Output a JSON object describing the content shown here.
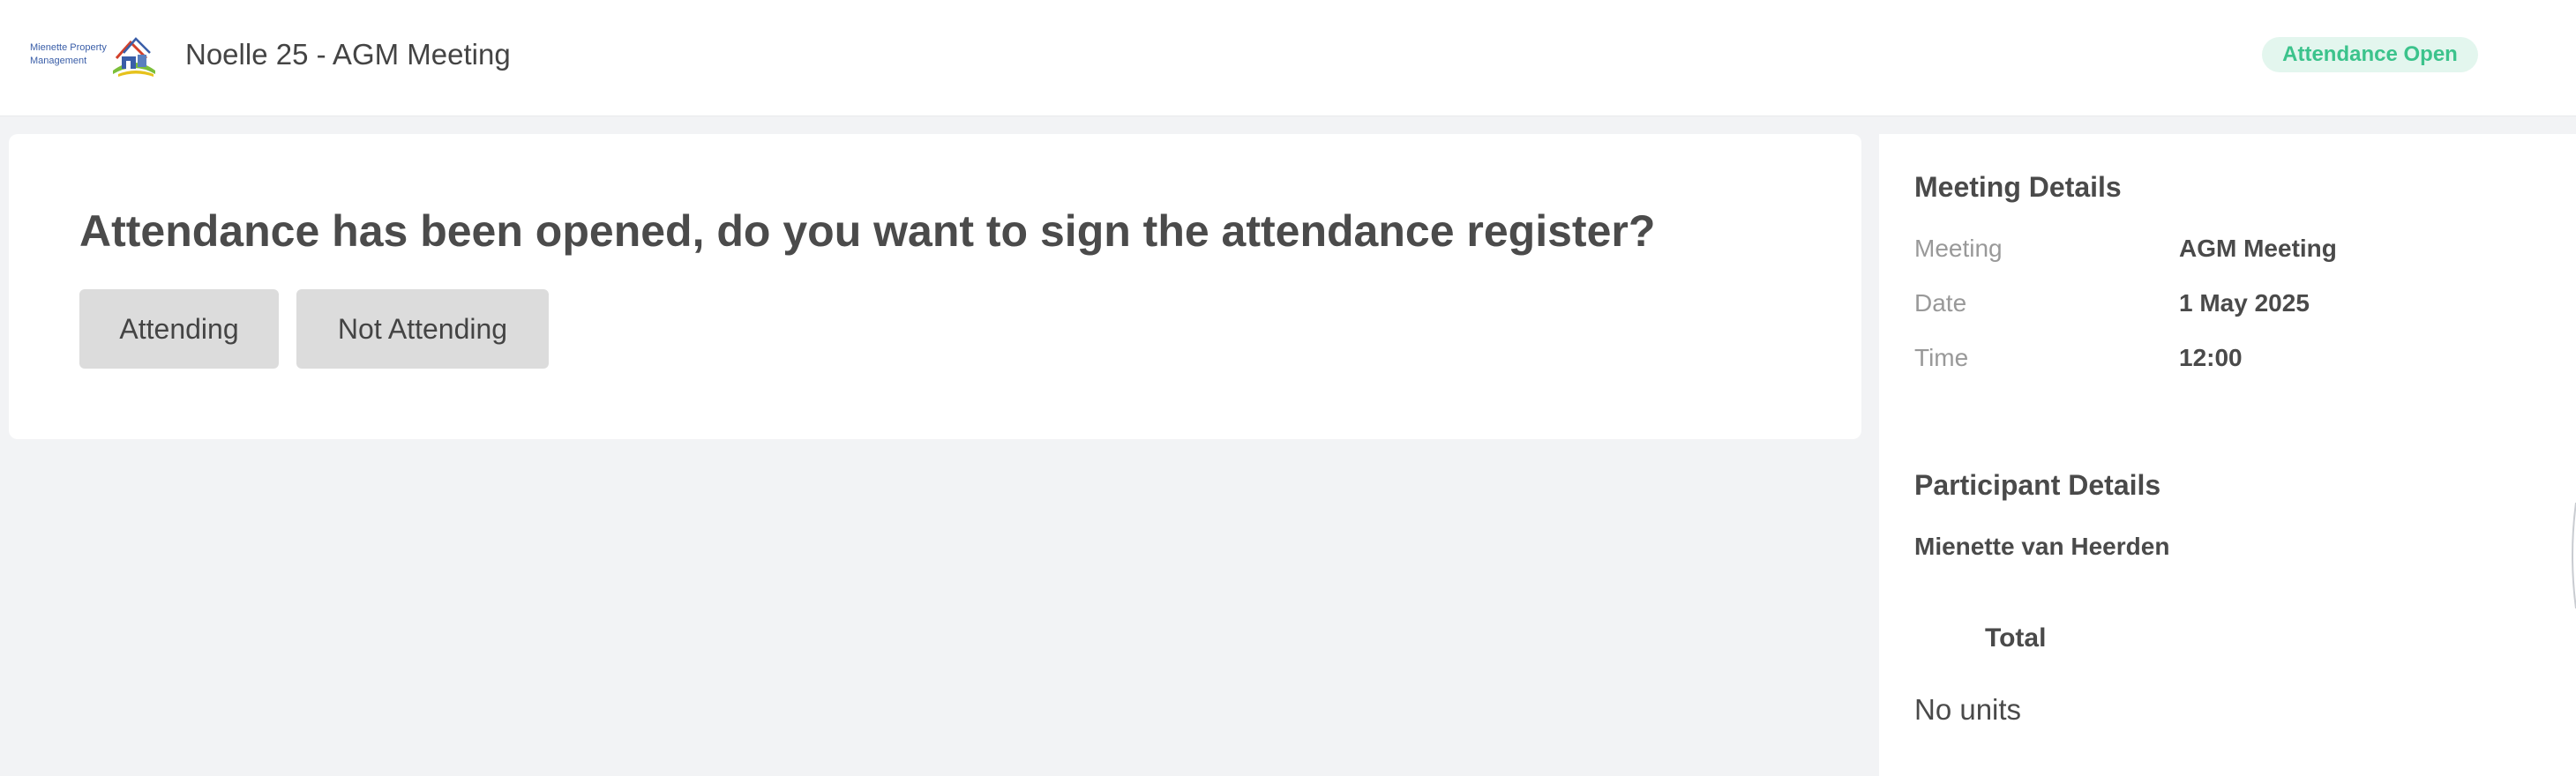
{
  "header": {
    "logo": {
      "line1": "Mienette Property",
      "line2": "Management",
      "icon": "house-logo-icon"
    },
    "title": "Noelle 25 - AGM Meeting",
    "status": "Attendance Open"
  },
  "prompt": {
    "question": "Attendance has been opened, do you want to sign the attendance register?",
    "attending_label": "Attending",
    "not_attending_label": "Not Attending"
  },
  "meeting_details": {
    "heading": "Meeting Details",
    "rows": [
      {
        "label": "Meeting",
        "value": "AGM Meeting"
      },
      {
        "label": "Date",
        "value": "1 May 2025"
      },
      {
        "label": "Time",
        "value": "12:00"
      }
    ]
  },
  "participant_details": {
    "heading": "Participant Details",
    "name": "Mienette van Heerden",
    "total_label": "Total",
    "units_text": "No units"
  },
  "colors": {
    "status_text": "#3cc38c",
    "status_bg": "#e3f6ee",
    "button_bg": "#dcdcdc",
    "page_bg": "#f2f3f5"
  }
}
